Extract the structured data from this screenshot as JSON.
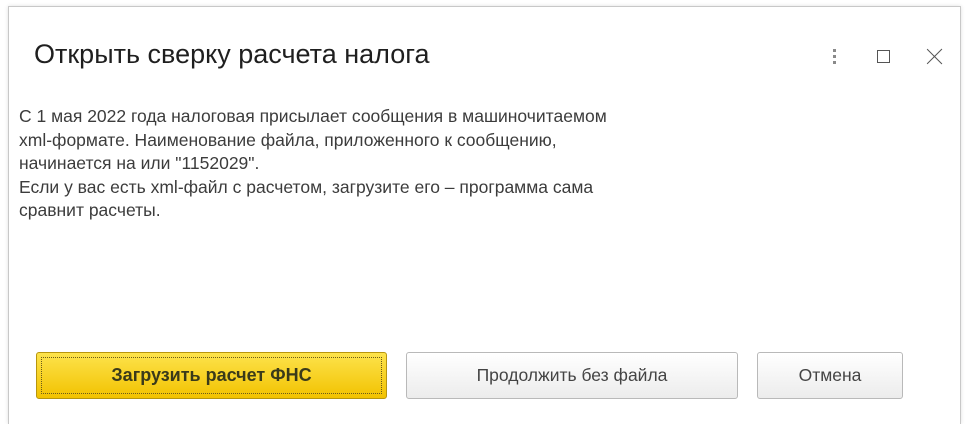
{
  "dialog": {
    "title": "Открыть сверку расчета налога",
    "controls": {
      "more_icon": "vertical-dots-icon",
      "maximize_icon": "maximize-icon",
      "close_icon": "close-icon"
    },
    "message": {
      "lines": [
        "С 1 мая 2022 года налоговая присылает сообщения в машиночитаемом",
        "xml-формате. Наименование файла, приложенного к сообщению,",
        "начинается на  или \"1152029\".",
        "Если у вас есть xml-файл с расчетом, загрузите его – программа сама",
        "сравнит расчеты."
      ]
    },
    "buttons": {
      "upload_label": "Загрузить расчет ФНС",
      "continue_label": "Продолжить без файла",
      "cancel_label": "Отмена"
    }
  },
  "colors": {
    "primary_button": "#f6d21c",
    "primary_border": "#b8960d",
    "text": "#3c3c3c"
  }
}
